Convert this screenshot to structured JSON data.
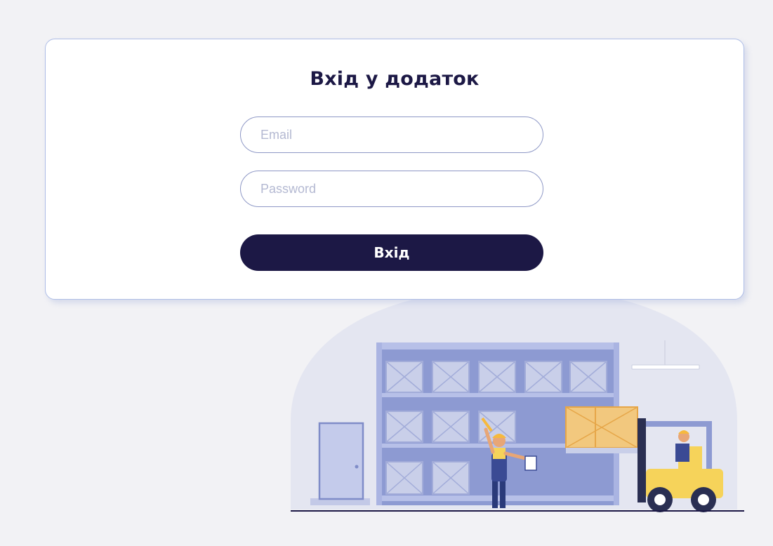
{
  "login": {
    "title": "Вхід у додаток",
    "email_placeholder": "Email",
    "password_placeholder": "Password",
    "submit_label": "Вхід"
  },
  "illustration": {
    "subject": "warehouse-illustration",
    "colors": {
      "page_background": "#f2f2f5",
      "card_border": "#aebde6",
      "primary": "#1c1845",
      "shelf": "#8d9ad2",
      "crate": "#f2c87e",
      "forklift": "#f6d35a"
    }
  }
}
